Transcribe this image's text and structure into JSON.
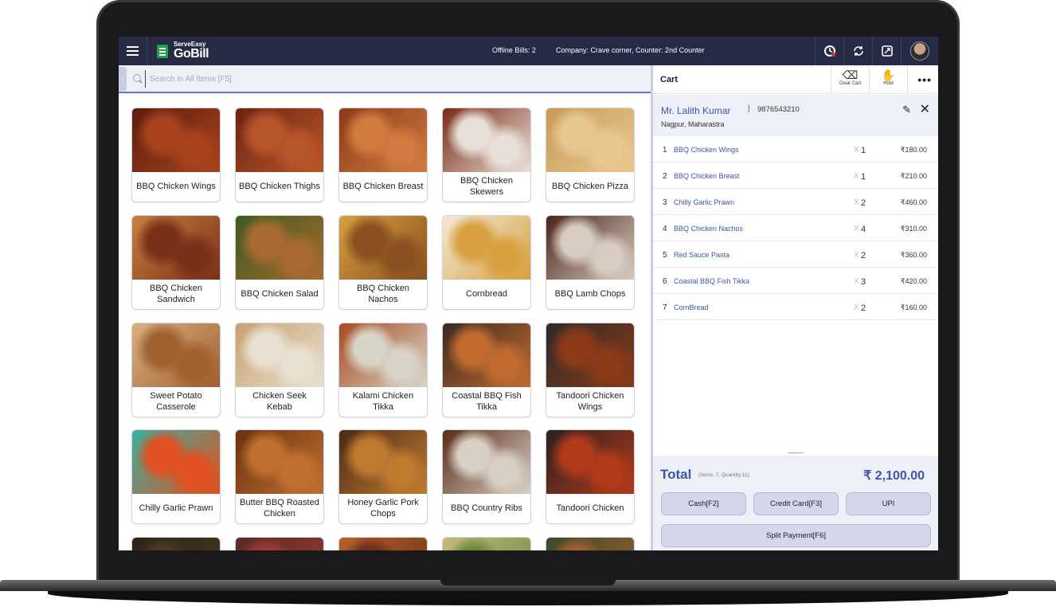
{
  "header": {
    "brand_small": "ServeEasy",
    "brand_big": "GoBill",
    "offline_bills": "Offline Bills: 2",
    "company_counter": "Company: Crave corner,  Counter: 2nd Counter"
  },
  "search": {
    "placeholder": "Search in All Items [F5]"
  },
  "items": [
    {
      "name": "BBQ Chicken Wings",
      "img": [
        "#5a1e0e",
        "#a8421d"
      ]
    },
    {
      "name": "BBQ Chicken Thighs",
      "img": [
        "#6a2412",
        "#b8542a"
      ]
    },
    {
      "name": "BBQ Chicken Breast",
      "img": [
        "#8a3a18",
        "#d07a40"
      ]
    },
    {
      "name": "BBQ Chicken Skewers",
      "img": [
        "#7a2a14",
        "#e8e0d8"
      ]
    },
    {
      "name": "BBQ Chicken Pizza",
      "img": [
        "#c89a5a",
        "#e8c890"
      ]
    },
    {
      "name": "BBQ Chicken Sandwich",
      "img": [
        "#c88040",
        "#7a3018"
      ]
    },
    {
      "name": "BBQ Chicken Salad",
      "img": [
        "#3c5a20",
        "#a86a30"
      ]
    },
    {
      "name": "BBQ Chicken Nachos",
      "img": [
        "#d8a040",
        "#8a5020"
      ]
    },
    {
      "name": "Cornbread",
      "img": [
        "#f2ead8",
        "#d8a040"
      ]
    },
    {
      "name": "BBQ Lamb Chops",
      "img": [
        "#4a2418",
        "#d8ccc0"
      ]
    },
    {
      "name": "Sweet Potato Casserole",
      "img": [
        "#d8b080",
        "#a06030"
      ]
    },
    {
      "name": "Chicken Seek Kebab",
      "img": [
        "#c8a070",
        "#e8e0d0"
      ]
    },
    {
      "name": "Kalami Chicken Tikka",
      "img": [
        "#a84a20",
        "#d8d4c8"
      ]
    },
    {
      "name": "Coastal BBQ Fish Tikka",
      "img": [
        "#3a2a20",
        "#c06a30"
      ]
    },
    {
      "name": "Tandoori Chicken Wings",
      "img": [
        "#2a2a2a",
        "#8a3a18"
      ]
    },
    {
      "name": "Chilly Garlic Prawn",
      "img": [
        "#3ab0a0",
        "#e05020"
      ]
    },
    {
      "name": "Butter BBQ Roasted Chicken",
      "img": [
        "#6a3010",
        "#c07030"
      ]
    },
    {
      "name": "Honey Garlic Pork Chops",
      "img": [
        "#4a2a18",
        "#c07a30"
      ]
    },
    {
      "name": "BBQ Country Ribs",
      "img": [
        "#5a2a18",
        "#d8d0c4"
      ]
    },
    {
      "name": "Tandoori Chicken",
      "img": [
        "#2a2020",
        "#b03a1a"
      ]
    },
    {
      "name": "",
      "img": [
        "#2a2418",
        "#4a3a20"
      ]
    },
    {
      "name": "",
      "img": [
        "#5a2a28",
        "#9a3a30"
      ]
    },
    {
      "name": "",
      "img": [
        "#b8602a",
        "#6a3018"
      ]
    },
    {
      "name": "",
      "img": [
        "#c8b880",
        "#6a8a3a"
      ]
    },
    {
      "name": "",
      "img": [
        "#3a4a28",
        "#a06030"
      ]
    }
  ],
  "cart": {
    "title": "Cart",
    "clear_label": "Clear Cart",
    "hold_label": "Hold",
    "more_label": "•••",
    "customer": {
      "name": "Mr. Lalith Kumar",
      "separator": "|",
      "phone": "9876543210",
      "city": "Nagpur, Maharastra"
    },
    "lines": [
      {
        "idx": "1",
        "name": "BBQ Chicken Wings",
        "x": "X",
        "qty": "1",
        "price": "₹180.00"
      },
      {
        "idx": "2",
        "name": "BBQ Chicken Breast",
        "x": "X",
        "qty": "1",
        "price": "₹210.00"
      },
      {
        "idx": "3",
        "name": "Chilly Garlic Prawn",
        "x": "X",
        "qty": "2",
        "price": "₹460.00"
      },
      {
        "idx": "4",
        "name": "BBQ Chicken Nachos",
        "x": "X",
        "qty": "4",
        "price": "₹310.00"
      },
      {
        "idx": "5",
        "name": "Red Sauce Pasta",
        "x": "X",
        "qty": "2",
        "price": "₹360.00"
      },
      {
        "idx": "6",
        "name": "Coastal BBQ Fish Tikka",
        "x": "X",
        "qty": "3",
        "price": "₹420.00"
      },
      {
        "idx": "7",
        "name": "CornBread",
        "x": "X",
        "qty": "2",
        "price": "₹160.00"
      }
    ],
    "total_label": "Total",
    "total_meta": "(Items: 7, Quantity:11)",
    "total_amount": "₹ 2,100.00",
    "pay_buttons": [
      "Cash[F2]",
      "Credit Card[F3]",
      "UPI",
      "Split Payment[F6]"
    ]
  },
  "colors": {
    "accent": "#3c55a8",
    "header_bg": "#262a44",
    "panel_bg": "#eef0f8"
  },
  "icons": [
    "menu-icon",
    "search-icon",
    "sync-status-icon",
    "refresh-icon",
    "fullscreen-icon",
    "clear-cart-icon",
    "hold-hand-icon",
    "edit-icon",
    "close-icon"
  ]
}
